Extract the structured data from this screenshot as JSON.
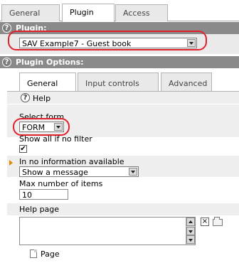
{
  "top_tabs": [
    "General",
    "Plugin",
    "Access"
  ],
  "plugin_section": {
    "title": "Plugin:",
    "selected": "SAV Example7 - Guest book"
  },
  "options_section": {
    "title": "Plugin Options:"
  },
  "inner_tabs": [
    "General",
    "Input controls",
    "Advanced"
  ],
  "help_label": "Help",
  "fields": {
    "select_form": {
      "label": "Select form",
      "value": "FORM"
    },
    "show_all": {
      "label": "Show all if no filter",
      "checked": "✔"
    },
    "no_info": {
      "label": "In no information available",
      "value": "Show a message"
    },
    "max_items": {
      "label": "Max number of items",
      "value": "10"
    },
    "help_page": {
      "label": "Help page"
    },
    "page_link": "Page"
  },
  "colors": {
    "section_bar": "#8a8a8a",
    "highlight": "#e0202a",
    "marker": "#e08a00"
  }
}
